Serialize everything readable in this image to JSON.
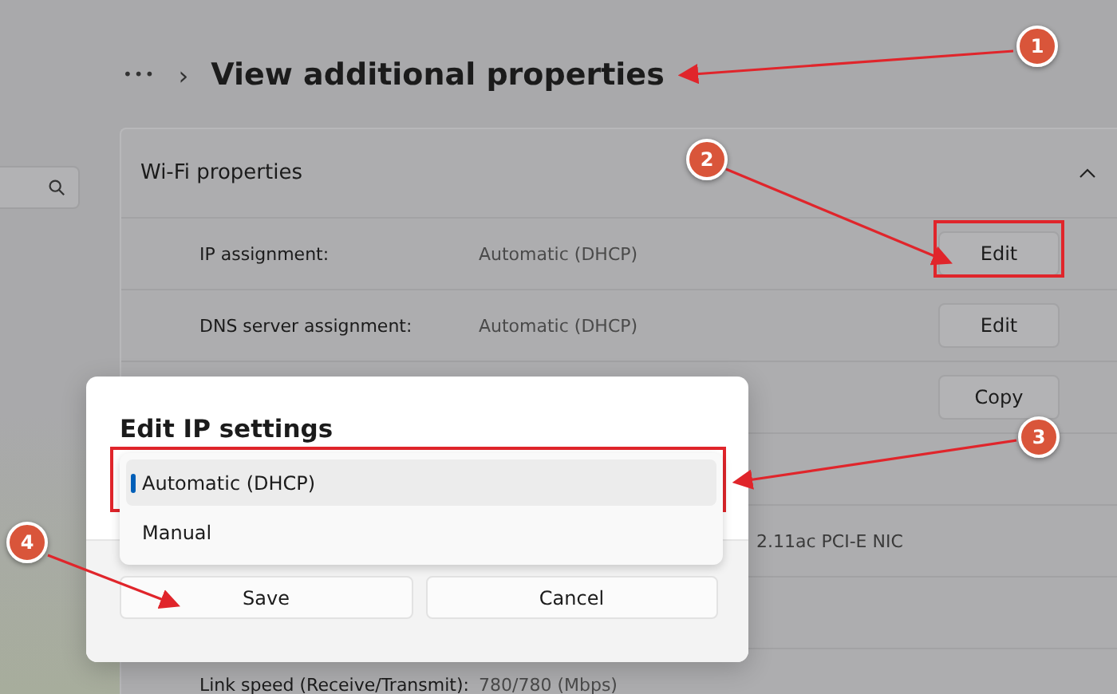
{
  "header": {
    "more": "•••",
    "separator": "›",
    "title": "View additional properties"
  },
  "section": {
    "title": "Wi-Fi properties",
    "expanded": true
  },
  "rows": [
    {
      "label": "IP assignment:",
      "value": "Automatic (DHCP)",
      "button": "Edit"
    },
    {
      "label": "DNS server assignment:",
      "value": "Automatic (DHCP)",
      "button": "Edit"
    },
    {
      "button": "Copy"
    },
    {},
    {
      "value_tail": "2.11ac PCI-E NIC"
    },
    {},
    {
      "label": "Link speed (Receive/Transmit):",
      "value": "780/780 (Mbps)"
    }
  ],
  "dialog": {
    "title": "Edit IP settings",
    "options": [
      {
        "label": "Automatic (DHCP)",
        "selected": true
      },
      {
        "label": "Manual",
        "selected": false
      }
    ],
    "buttons": [
      "Save",
      "Cancel"
    ]
  },
  "annotations": [
    "1",
    "2",
    "3",
    "4"
  ]
}
